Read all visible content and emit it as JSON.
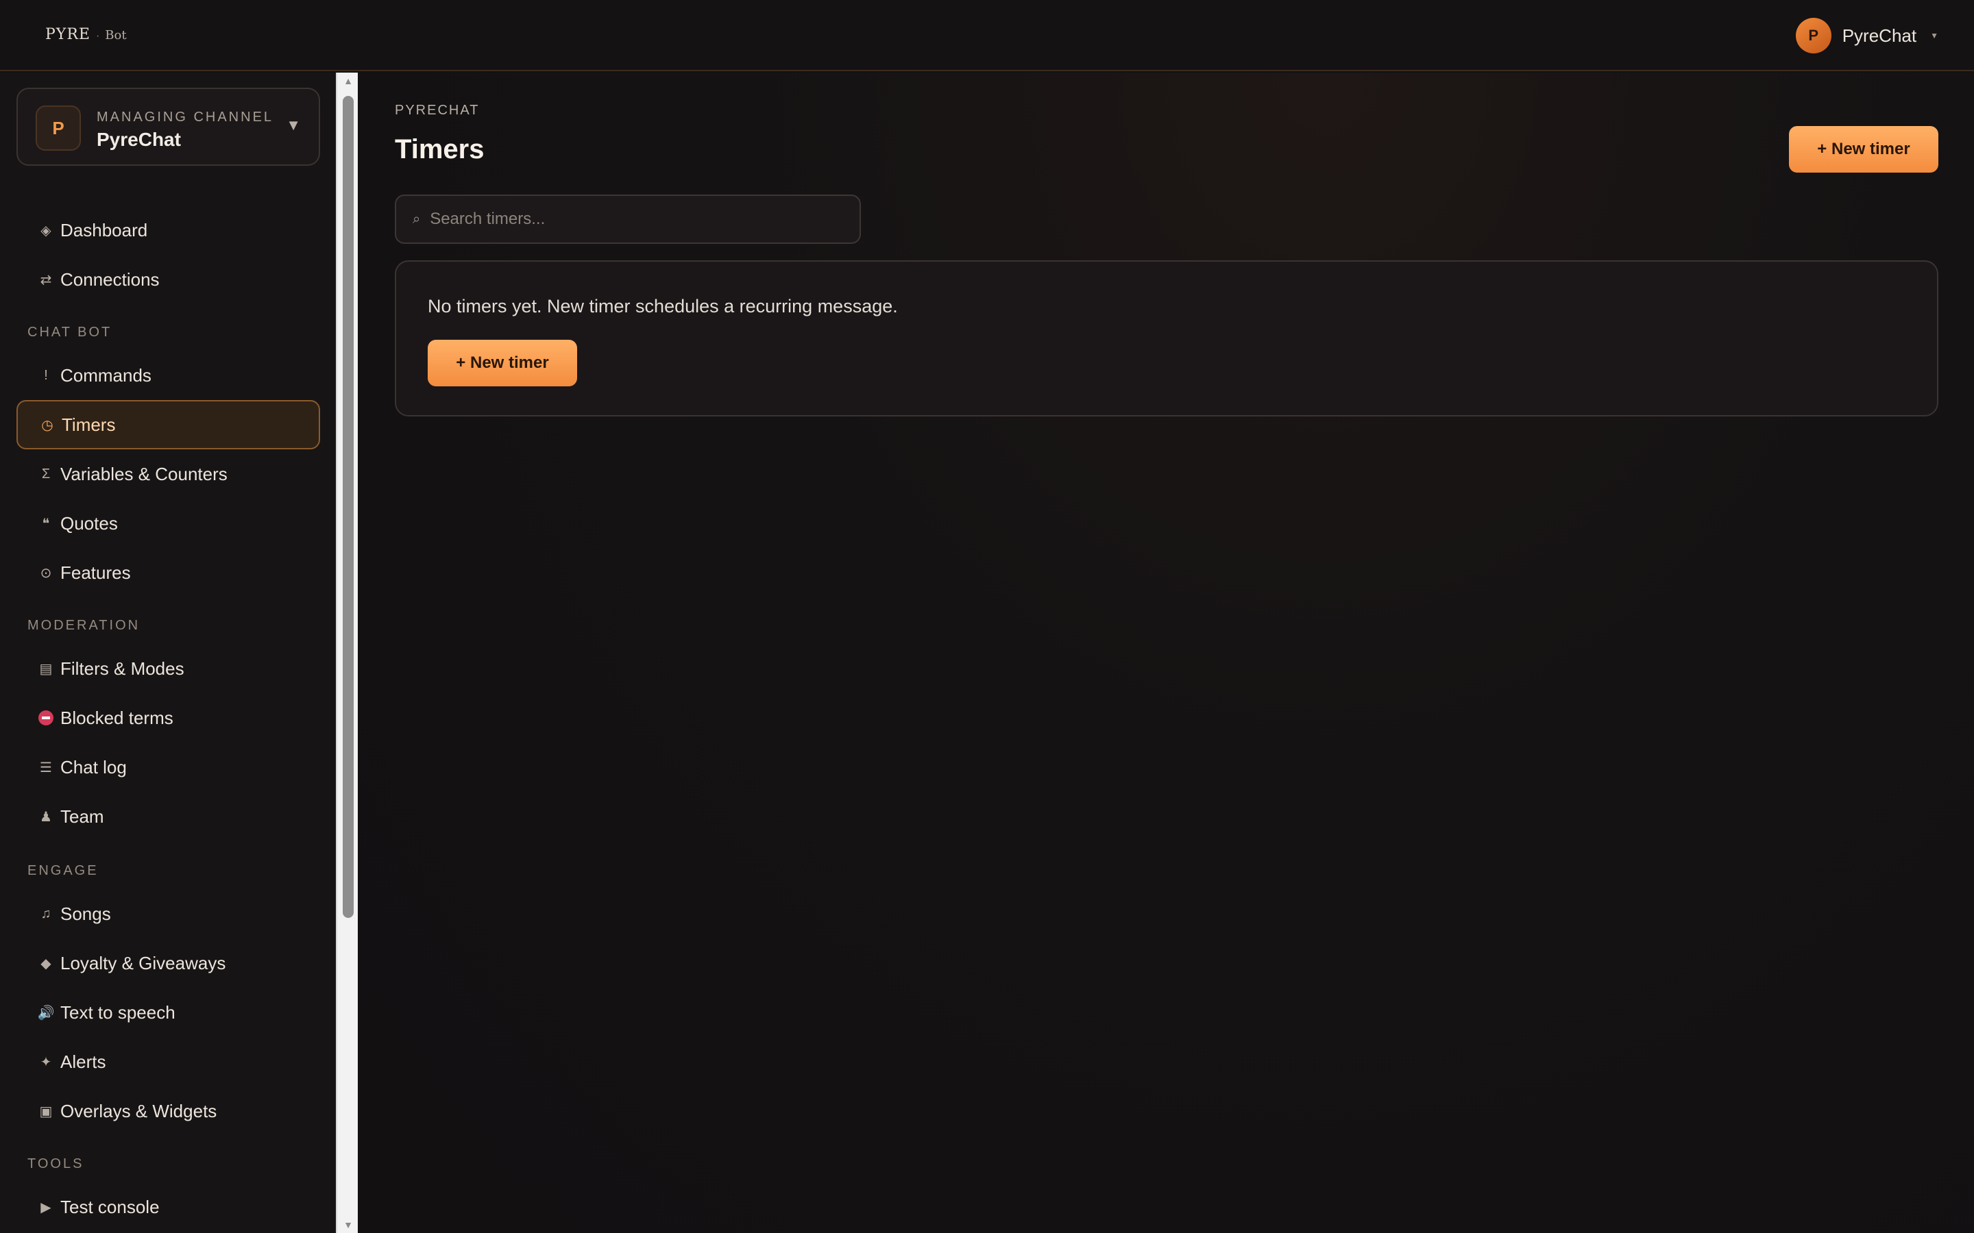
{
  "app": {
    "logo_text": "PYRE",
    "logo_separator": "·",
    "logo_sub": "Bot"
  },
  "user": {
    "avatar_initial": "P",
    "name": "PyreChat"
  },
  "channel": {
    "label": "MANAGING CHANNEL",
    "avatar_initial": "P",
    "name": "PyreChat"
  },
  "nav": {
    "dashboard": {
      "icon": "◈",
      "label": "Dashboard"
    },
    "connections": {
      "icon": "⇄",
      "label": "Connections"
    },
    "section_chatbot": "CHAT BOT",
    "commands": {
      "icon": "!",
      "label": "Commands"
    },
    "timers": {
      "icon": "◷",
      "label": "Timers"
    },
    "variables": {
      "icon": "Σ",
      "label": "Variables & Counters"
    },
    "quotes": {
      "icon": "❝",
      "label": "Quotes"
    },
    "features": {
      "icon": "⊙",
      "label": "Features"
    },
    "section_moderation": "MODERATION",
    "filters": {
      "icon": "▤",
      "label": "Filters & Modes"
    },
    "blocked": {
      "label": "Blocked terms"
    },
    "chatlog": {
      "icon": "☰",
      "label": "Chat log"
    },
    "team": {
      "icon": "♟",
      "label": "Team"
    },
    "section_engage": "ENGAGE",
    "songs": {
      "icon": "♫",
      "label": "Songs"
    },
    "loyalty": {
      "icon": "◆",
      "label": "Loyalty & Giveaways"
    },
    "tts": {
      "icon": "🔊",
      "label": "Text to speech"
    },
    "alerts": {
      "icon": "✦",
      "label": "Alerts"
    },
    "overlays": {
      "icon": "▣",
      "label": "Overlays & Widgets"
    },
    "section_tools": "TOOLS",
    "console": {
      "icon": "▶",
      "label": "Test console"
    }
  },
  "main": {
    "breadcrumb": "PYRECHAT",
    "title": "Timers",
    "new_timer_label": "+ New timer",
    "search_placeholder": "Search timers...",
    "empty_message": "No timers yet. New timer schedules a recurring message.",
    "empty_button_label": "+ New timer"
  },
  "colors": {
    "accent": "#f48c3e",
    "background": "#131112",
    "blocked": "#d63a5a"
  }
}
